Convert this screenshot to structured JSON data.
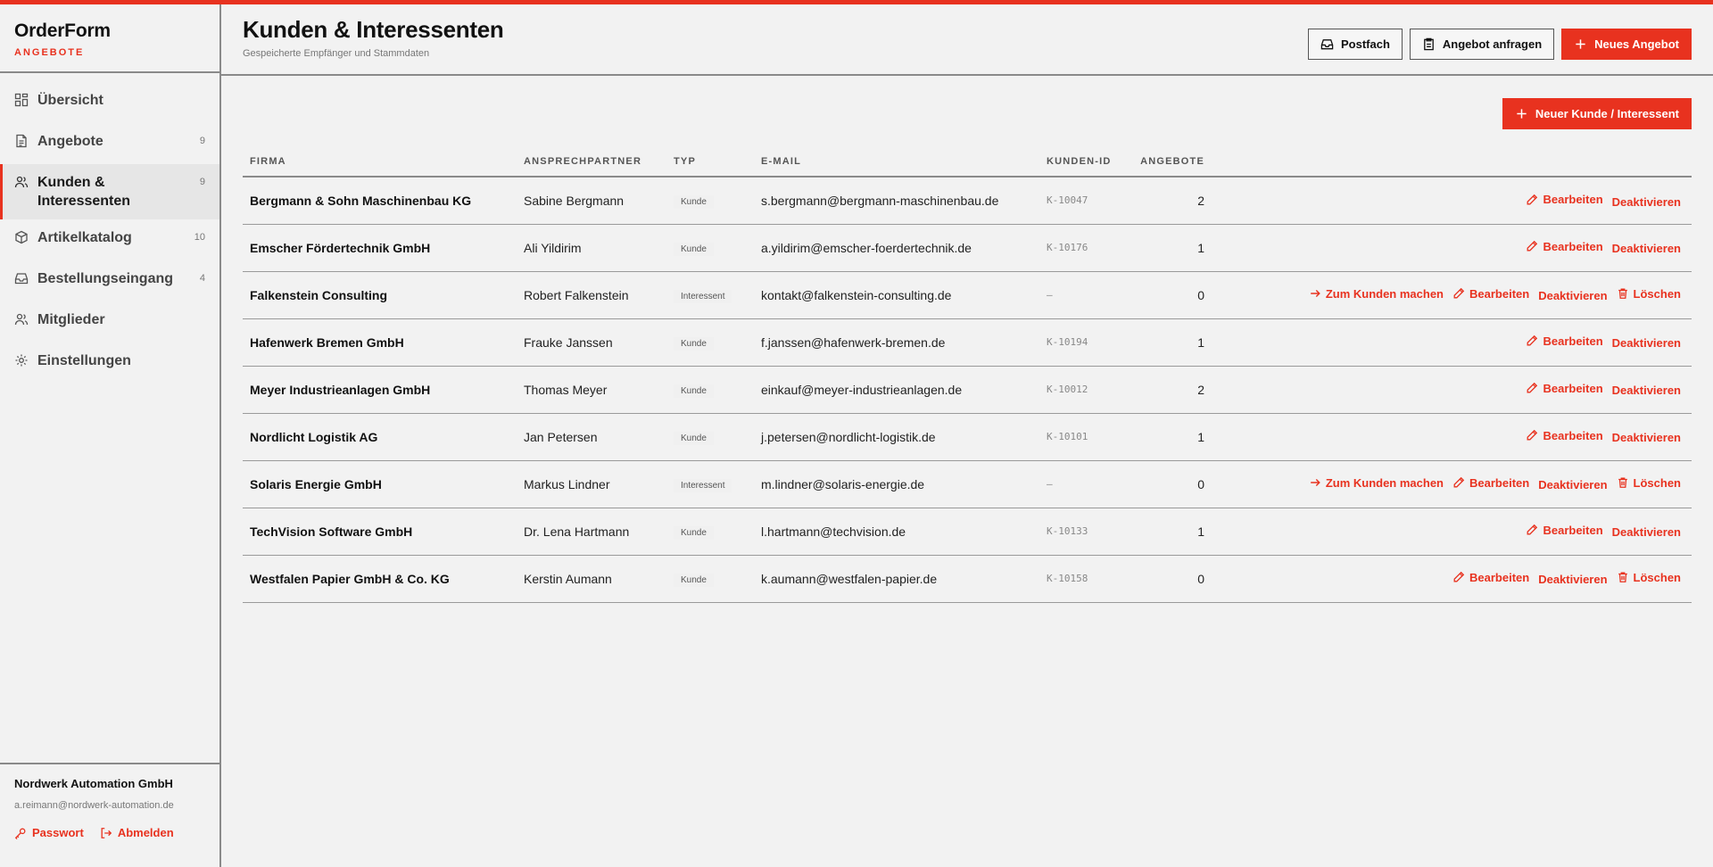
{
  "brand": {
    "name": "OrderForm",
    "sub": "ANGEBOTE"
  },
  "nav": [
    {
      "label": "Übersicht",
      "count": "",
      "icon": "dashboard-icon"
    },
    {
      "label": "Angebote",
      "count": "9",
      "icon": "document-icon"
    },
    {
      "label": "Kunden & Interessenten",
      "count": "9",
      "icon": "users-icon",
      "active": true
    },
    {
      "label": "Artikelkatalog",
      "count": "10",
      "icon": "box-icon"
    },
    {
      "label": "Bestellungseingang",
      "count": "4",
      "icon": "inbox-icon"
    },
    {
      "label": "Mitglieder",
      "count": "",
      "icon": "members-icon"
    },
    {
      "label": "Einstellungen",
      "count": "",
      "icon": "gear-icon"
    }
  ],
  "footer": {
    "org": "Nordwerk Automation GmbH",
    "email": "a.reimann@nordwerk-automation.de",
    "password_label": "Passwort",
    "logout_label": "Abmelden"
  },
  "header": {
    "title": "Kunden & Interessenten",
    "subtitle": "Gespeicherte Empfänger und Stammdaten",
    "postfach_label": "Postfach",
    "anfragen_label": "Angebot anfragen",
    "neues_angebot_label": "Neues Angebot"
  },
  "toolbar": {
    "new_customer_label": "Neuer Kunde / Interessent"
  },
  "table": {
    "columns": [
      "FIRMA",
      "ANSPRECHPARTNER",
      "TYP",
      "E-MAIL",
      "KUNDEN-ID",
      "ANGEBOTE"
    ],
    "action_labels": {
      "convert": "Zum Kunden machen",
      "edit": "Bearbeiten",
      "deactivate": "Deaktivieren",
      "delete": "Löschen"
    },
    "rows": [
      {
        "firma": "Bergmann & Sohn Maschinenbau KG",
        "contact": "Sabine Bergmann",
        "type": "Kunde",
        "email": "s.bergmann@bergmann-maschinenbau.de",
        "id": "K-10047",
        "offers": "2",
        "convert": false,
        "delete": false
      },
      {
        "firma": "Emscher Fördertechnik GmbH",
        "contact": "Ali Yildirim",
        "type": "Kunde",
        "email": "a.yildirim@emscher-foerdertechnik.de",
        "id": "K-10176",
        "offers": "1",
        "convert": false,
        "delete": false
      },
      {
        "firma": "Falkenstein Consulting",
        "contact": "Robert Falkenstein",
        "type": "Interessent",
        "email": "kontakt@falkenstein-consulting.de",
        "id": "–",
        "offers": "0",
        "convert": true,
        "delete": true
      },
      {
        "firma": "Hafenwerk Bremen GmbH",
        "contact": "Frauke Janssen",
        "type": "Kunde",
        "email": "f.janssen@hafenwerk-bremen.de",
        "id": "K-10194",
        "offers": "1",
        "convert": false,
        "delete": false
      },
      {
        "firma": "Meyer Industrieanlagen GmbH",
        "contact": "Thomas Meyer",
        "type": "Kunde",
        "email": "einkauf@meyer-industrieanlagen.de",
        "id": "K-10012",
        "offers": "2",
        "convert": false,
        "delete": false
      },
      {
        "firma": "Nordlicht Logistik AG",
        "contact": "Jan Petersen",
        "type": "Kunde",
        "email": "j.petersen@nordlicht-logistik.de",
        "id": "K-10101",
        "offers": "1",
        "convert": false,
        "delete": false
      },
      {
        "firma": "Solaris Energie GmbH",
        "contact": "Markus Lindner",
        "type": "Interessent",
        "email": "m.lindner@solaris-energie.de",
        "id": "–",
        "offers": "0",
        "convert": true,
        "delete": true
      },
      {
        "firma": "TechVision Software GmbH",
        "contact": "Dr. Lena Hartmann",
        "type": "Kunde",
        "email": "l.hartmann@techvision.de",
        "id": "K-10133",
        "offers": "1",
        "convert": false,
        "delete": false
      },
      {
        "firma": "Westfalen Papier GmbH & Co. KG",
        "contact": "Kerstin Aumann",
        "type": "Kunde",
        "email": "k.aumann@westfalen-papier.de",
        "id": "K-10158",
        "offers": "0",
        "convert": false,
        "delete": true
      }
    ]
  },
  "colors": {
    "accent": "#e8321f",
    "background": "#f2f2f2",
    "border": "#8a8a8a"
  }
}
